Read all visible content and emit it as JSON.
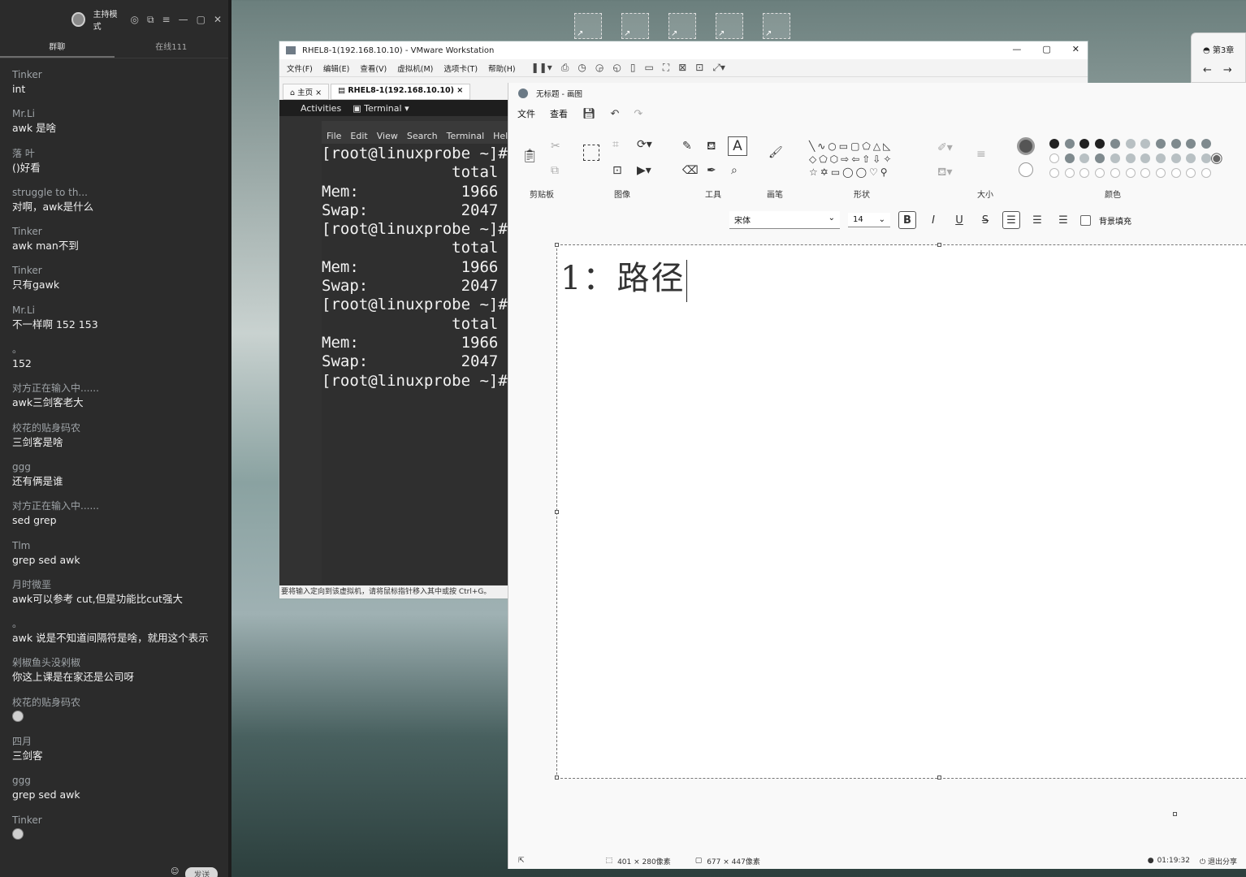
{
  "chat": {
    "mode_label": "主持模式",
    "tabs": [
      "群聊",
      "在线111"
    ],
    "messages": [
      {
        "sender": "Tinker",
        "text": "int"
      },
      {
        "sender": "Mr.Li",
        "text": "awk   是啥"
      },
      {
        "sender": "落   叶",
        "text": "()好看"
      },
      {
        "sender": "struggle to th...",
        "text": "对啊，awk是什么"
      },
      {
        "sender": "Tinker",
        "text": "awk man不到"
      },
      {
        "sender": "Tinker",
        "text": "只有gawk"
      },
      {
        "sender": "Mr.Li",
        "text": "不一样啊 152  153"
      },
      {
        "sender": "。",
        "text": "152"
      },
      {
        "sender": "对方正在输入中......",
        "text": "awk三剑客老大"
      },
      {
        "sender": "校花的贴身码农",
        "text": "三剑客是啥"
      },
      {
        "sender": "ggg",
        "text": "还有俩是谁"
      },
      {
        "sender": "对方正在输入中......",
        "text": "sed   grep"
      },
      {
        "sender": "Tlm",
        "text": "grep sed awk"
      },
      {
        "sender": "月时微垩",
        "text": "awk可以参考 cut,但是功能比cut强大"
      },
      {
        "sender": "。",
        "text": "awk 说是不知道间隔符是啥，就用这个表示"
      },
      {
        "sender": "剁椒鱼头没剁椒",
        "text": "你这上课是在家还是公司呀"
      },
      {
        "sender": "校花的贴身码农",
        "text": "",
        "emoji": "emoji-icon"
      },
      {
        "sender": "四月",
        "text": "三剑客"
      },
      {
        "sender": "ggg",
        "text": "grep sed awk"
      },
      {
        "sender": "Tinker",
        "text": "",
        "emoji": "emoji-icon"
      }
    ],
    "send_label": "发送"
  },
  "vmware": {
    "title": "RHEL8-1(192.168.10.10) - VMware Workstation",
    "menu": [
      "文件(F)",
      "编辑(E)",
      "查看(V)",
      "虚拟机(M)",
      "选项卡(T)",
      "帮助(H)"
    ],
    "tabs": [
      "主页",
      "RHEL8-1(192.168.10.10)"
    ],
    "gnome": {
      "activities": "Activities",
      "app": "Terminal ▾"
    },
    "terminal_menu": [
      "File",
      "Edit",
      "View",
      "Search",
      "Terminal",
      "Help"
    ],
    "terminal_lines": [
      "[root@linuxprobe ~]#",
      "              total",
      "Mem:           1966",
      "Swap:          2047",
      "[root@linuxprobe ~]#",
      "              total",
      "Mem:           1966",
      "Swap:          2047",
      "[root@linuxprobe ~]#",
      "              total",
      "Mem:           1966",
      "Swap:          2047",
      "[root@linuxprobe ~]#"
    ],
    "status": "要将输入定向到该虚拟机，请将鼠标指针移入其中或按 Ctrl+G。"
  },
  "browser": {
    "tab": "第3章"
  },
  "paint": {
    "title": "无标题 - 画图",
    "menu": [
      "文件",
      "查看"
    ],
    "groups": [
      "剪贴板",
      "图像",
      "工具",
      "画笔",
      "形状",
      "大小",
      "颜色"
    ],
    "font_name": "宋体",
    "font_size": "14",
    "bg_fill_label": "背景填充",
    "canvas_text": "1：路径",
    "status": {
      "selection": "401 × 280像素",
      "canvas": "677 × 447像素"
    },
    "timer": "01:19:32",
    "exit_share": "退出分享",
    "icons": {
      "bold": "B",
      "italic": "I",
      "underline": "U",
      "strike": "S"
    }
  }
}
